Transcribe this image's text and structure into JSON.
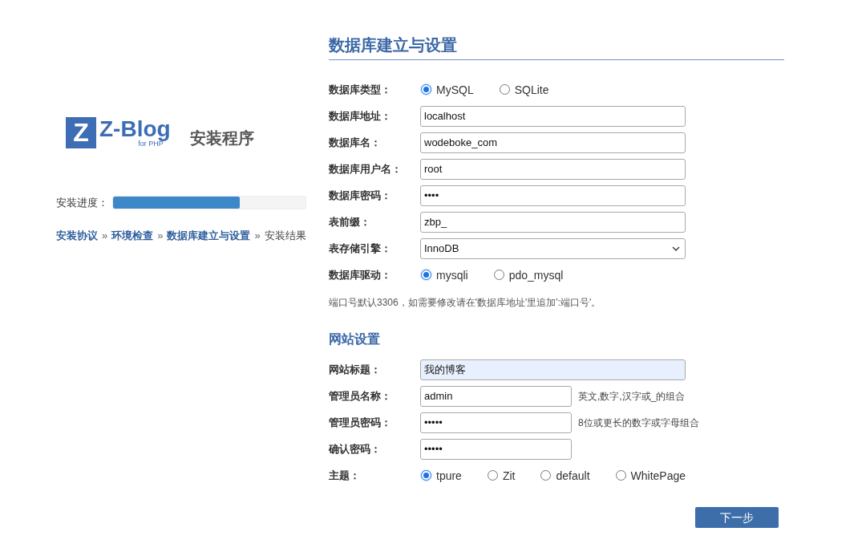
{
  "logo": {
    "mark_letter": "Z",
    "wordmark": "Z-Blog",
    "tagline": "for PHP"
  },
  "app_title": "安装程序",
  "progress": {
    "label": "安装进度：",
    "level": 0.66
  },
  "steps": [
    {
      "label": "安装协议",
      "done": true
    },
    {
      "separator": "»",
      "label": "环境检查",
      "done": true
    },
    {
      "separator": "»",
      "label": "数据库建立与设置",
      "done": true
    },
    {
      "separator": "»",
      "label": "安装结果",
      "done": false
    }
  ],
  "database": {
    "title": "数据库建立与设置",
    "fields": [
      {
        "kind": "radio",
        "label": "数据库类型：",
        "options": [
          {
            "label": "MySQL",
            "selected": true
          },
          {
            "label": "SQLite",
            "selected": false
          }
        ]
      },
      {
        "kind": "text",
        "label": "数据库地址：",
        "value": "localhost"
      },
      {
        "kind": "text",
        "label": "数据库名：",
        "value": "wodeboke_com"
      },
      {
        "kind": "text",
        "label": "数据库用户名：",
        "value": "root"
      },
      {
        "kind": "password",
        "label": "数据库密码：",
        "value": "••••"
      },
      {
        "kind": "text",
        "label": "表前缀：",
        "value": "zbp_"
      },
      {
        "kind": "select",
        "label": "表存储引擎：",
        "value": "InnoDB"
      },
      {
        "kind": "radio",
        "label": "数据库驱动：",
        "options": [
          {
            "label": "mysqli",
            "selected": true
          },
          {
            "label": "pdo_mysql",
            "selected": false
          }
        ]
      }
    ],
    "note": "端口号默认3306，如需要修改请在'数据库地址'里追加':端口号'。"
  },
  "site": {
    "title": "网站设置",
    "fields": [
      {
        "kind": "text",
        "label": "网站标题：",
        "value": "我的博客",
        "autofilled": true
      },
      {
        "kind": "text",
        "label": "管理员名称：",
        "value": "admin",
        "autofilled": false,
        "hint": "英文,数字,汉字或_的组合"
      },
      {
        "kind": "password",
        "label": "管理员密码：",
        "value": "•••••",
        "autofilled": false,
        "hint": "8位或更长的数字或字母组合"
      },
      {
        "kind": "password",
        "label": "确认密码：",
        "value": "•••••",
        "autofilled": false
      },
      {
        "kind": "radio",
        "label": "主题：",
        "options": [
          {
            "label": "tpure",
            "selected": true
          },
          {
            "label": "Zit",
            "selected": false
          },
          {
            "label": "default",
            "selected": false
          },
          {
            "label": "WhitePage",
            "selected": false
          }
        ]
      }
    ]
  },
  "next_button": "下一步"
}
